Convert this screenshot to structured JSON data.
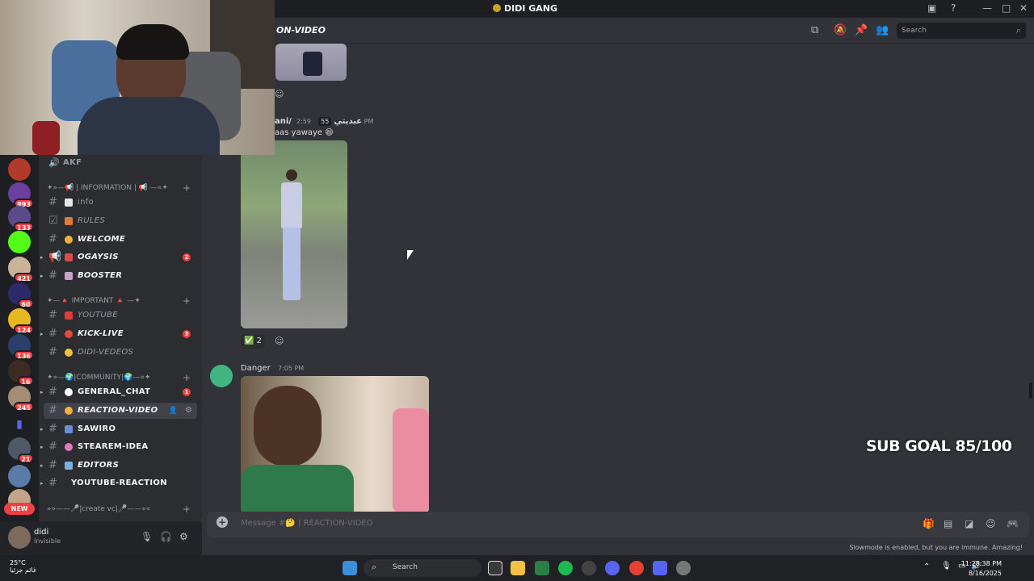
{
  "titlebar": {
    "title": "DIDI GANG"
  },
  "header": {
    "channel_name": "REACTION-VIDEO",
    "channel_name_fragment": "ON-VIDEO",
    "search_placeholder": "Search"
  },
  "servers": [
    {
      "badge": ""
    },
    {
      "badge": "993"
    },
    {
      "badge": "133"
    },
    {
      "badge": ""
    },
    {
      "badge": "421"
    },
    {
      "badge": "60"
    },
    {
      "badge": "124"
    },
    {
      "badge": "136"
    },
    {
      "badge": "16"
    },
    {
      "badge": "245"
    },
    {
      "badge": ""
    },
    {
      "badge": "21"
    },
    {
      "badge": ""
    },
    {
      "badge": ""
    }
  ],
  "new_label": "NEW",
  "voice_channel": {
    "label": "AKF"
  },
  "categories": [
    {
      "label": "✦»—📢 | INFORMATION | 📢 —«✦",
      "channels": [
        {
          "name": "info"
        },
        {
          "name": "RULES"
        },
        {
          "name": "WELCOME"
        },
        {
          "name": "OGAYSIS",
          "count": "2"
        },
        {
          "name": "BOOSTER"
        }
      ]
    },
    {
      "label": "✦—🔺 IMPORTANT 🔺 —✦",
      "channels": [
        {
          "name": "YOUTUBE"
        },
        {
          "name": "KICK-LIVE",
          "count": "3"
        },
        {
          "name": "DIDI-VEDEOS"
        }
      ]
    },
    {
      "label": "✦»—🌍|COMMUNITY|🌍—«✦",
      "channels": [
        {
          "name": "GENERAL_CHAT",
          "count": "1"
        },
        {
          "name": "REACTION-VIDEO"
        },
        {
          "name": "SAWIRO"
        },
        {
          "name": "STEAREM-IDEA"
        },
        {
          "name": "EDITORS"
        },
        {
          "name": "YOUTUBE-REACTION"
        }
      ]
    },
    {
      "label": "»»——🎤|create vc|🎤——««",
      "channels": []
    }
  ],
  "user": {
    "name": "didi",
    "status": "Invisible"
  },
  "messages": [
    {
      "author": "ani/عبديتي",
      "badge": "55",
      "time": "2:59 PM",
      "text": "aas yawaye 😆",
      "reaction_count": "2"
    },
    {
      "author": "Danger",
      "time": "7:05 PM"
    }
  ],
  "composer": {
    "placeholder": "Message #🤔 | REACTION-VIDEO"
  },
  "slowmode": "Slowmode is enabled, but you are immune. Amazing!",
  "overlay": {
    "sub_goal": "SUB GOAL 85/100"
  },
  "taskbar": {
    "weather_temp": "25°C",
    "weather_desc": "غائم جزئيا",
    "search": "Search",
    "time": "11:28:38 PM",
    "date": "8/16/2025"
  },
  "colors": {
    "accent": "#5865f2",
    "danger": "#f23f42",
    "bg": "#313338",
    "sidebar": "#2b2d31"
  }
}
